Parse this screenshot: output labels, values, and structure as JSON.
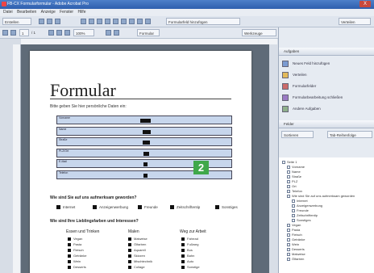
{
  "window": {
    "title": "FB-CX Formularformular - Adobe Acrobat Pro",
    "close_label": "X"
  },
  "menu": [
    "Datei",
    "Bearbeiten",
    "Anzeige",
    "Fenster",
    "Hilfe"
  ],
  "toolbar": {
    "create_label": "Erstellen",
    "zoom_value": "100%",
    "form_label": "Formular",
    "page_value": "1",
    "page_of": "/ 1",
    "tools_label": "Werkzeuge",
    "task_label": "Formularfeld hinzufügen",
    "distribute_label": "Verteilen"
  },
  "document": {
    "title": "Formular",
    "intro": "Bitte geben Sie hier persönliche Daten ein:",
    "fields": [
      {
        "label": "Vorname"
      },
      {
        "label": "Name"
      },
      {
        "label": "Straße"
      },
      {
        "label": "PLZ/Ort"
      },
      {
        "label": "E-Mail"
      },
      {
        "label": "Telefon"
      }
    ],
    "badge": "2",
    "q1": "Wie sind Sie auf uns aufmerksam geworden?",
    "q1_options": [
      "Internet",
      "Anzeigenwerbung",
      "Freunde",
      "Zeitschriftentip",
      "Sonstiges"
    ],
    "q2": "Wie sind Ihre Lieblingsfarben und Interessen?",
    "columns": [
      {
        "head": "Essen und Trinken",
        "items": [
          "Vegan",
          "Pasta",
          "Fleisch",
          "Getränke",
          "Wein",
          "Desserts"
        ]
      },
      {
        "head": "Malen",
        "items": [
          "Malweise",
          "Ölfarben",
          "Aquarell",
          "Skizzen",
          "Mischtechnik",
          "Collage"
        ]
      },
      {
        "head": "Weg zur Arbeit",
        "items": [
          "Fahrrad",
          "Fußweg",
          "Bus",
          "Bahn",
          "Auto",
          "Sonstige"
        ]
      }
    ]
  },
  "sidebar": {
    "tasks_head": "Aufgaben",
    "tasks": [
      {
        "label": "Neues Feld hinzufügen",
        "color": "#7b9bd1"
      },
      {
        "label": "Verteilen",
        "color": "#e2b95a"
      },
      {
        "label": "Formularfelder",
        "color": "#cc6b6b"
      },
      {
        "label": "Formularbearbeitung schließen",
        "color": "#9a7ac4"
      },
      {
        "label": "Andere Aufgaben",
        "color": "#8fb08b"
      }
    ],
    "fields_head": "Felder",
    "sort_label": "Sortieren",
    "order_label": "Tab-Reihenfolge",
    "tree": [
      "Seite 1",
      "Vorname",
      "Name",
      "Straße",
      "PLZ",
      "Ort",
      "Telefon",
      "Wie sind Sie auf uns aufmerksam geworden",
      "Internet",
      "Anzeigenwerbung",
      "Freunde",
      "Zeitschriftentip",
      "Sonstiges",
      "Vegan",
      "Pasta",
      "Fleisch",
      "Getränke",
      "Wein",
      "Desserts",
      "Malweise",
      "Ölfarben"
    ]
  }
}
